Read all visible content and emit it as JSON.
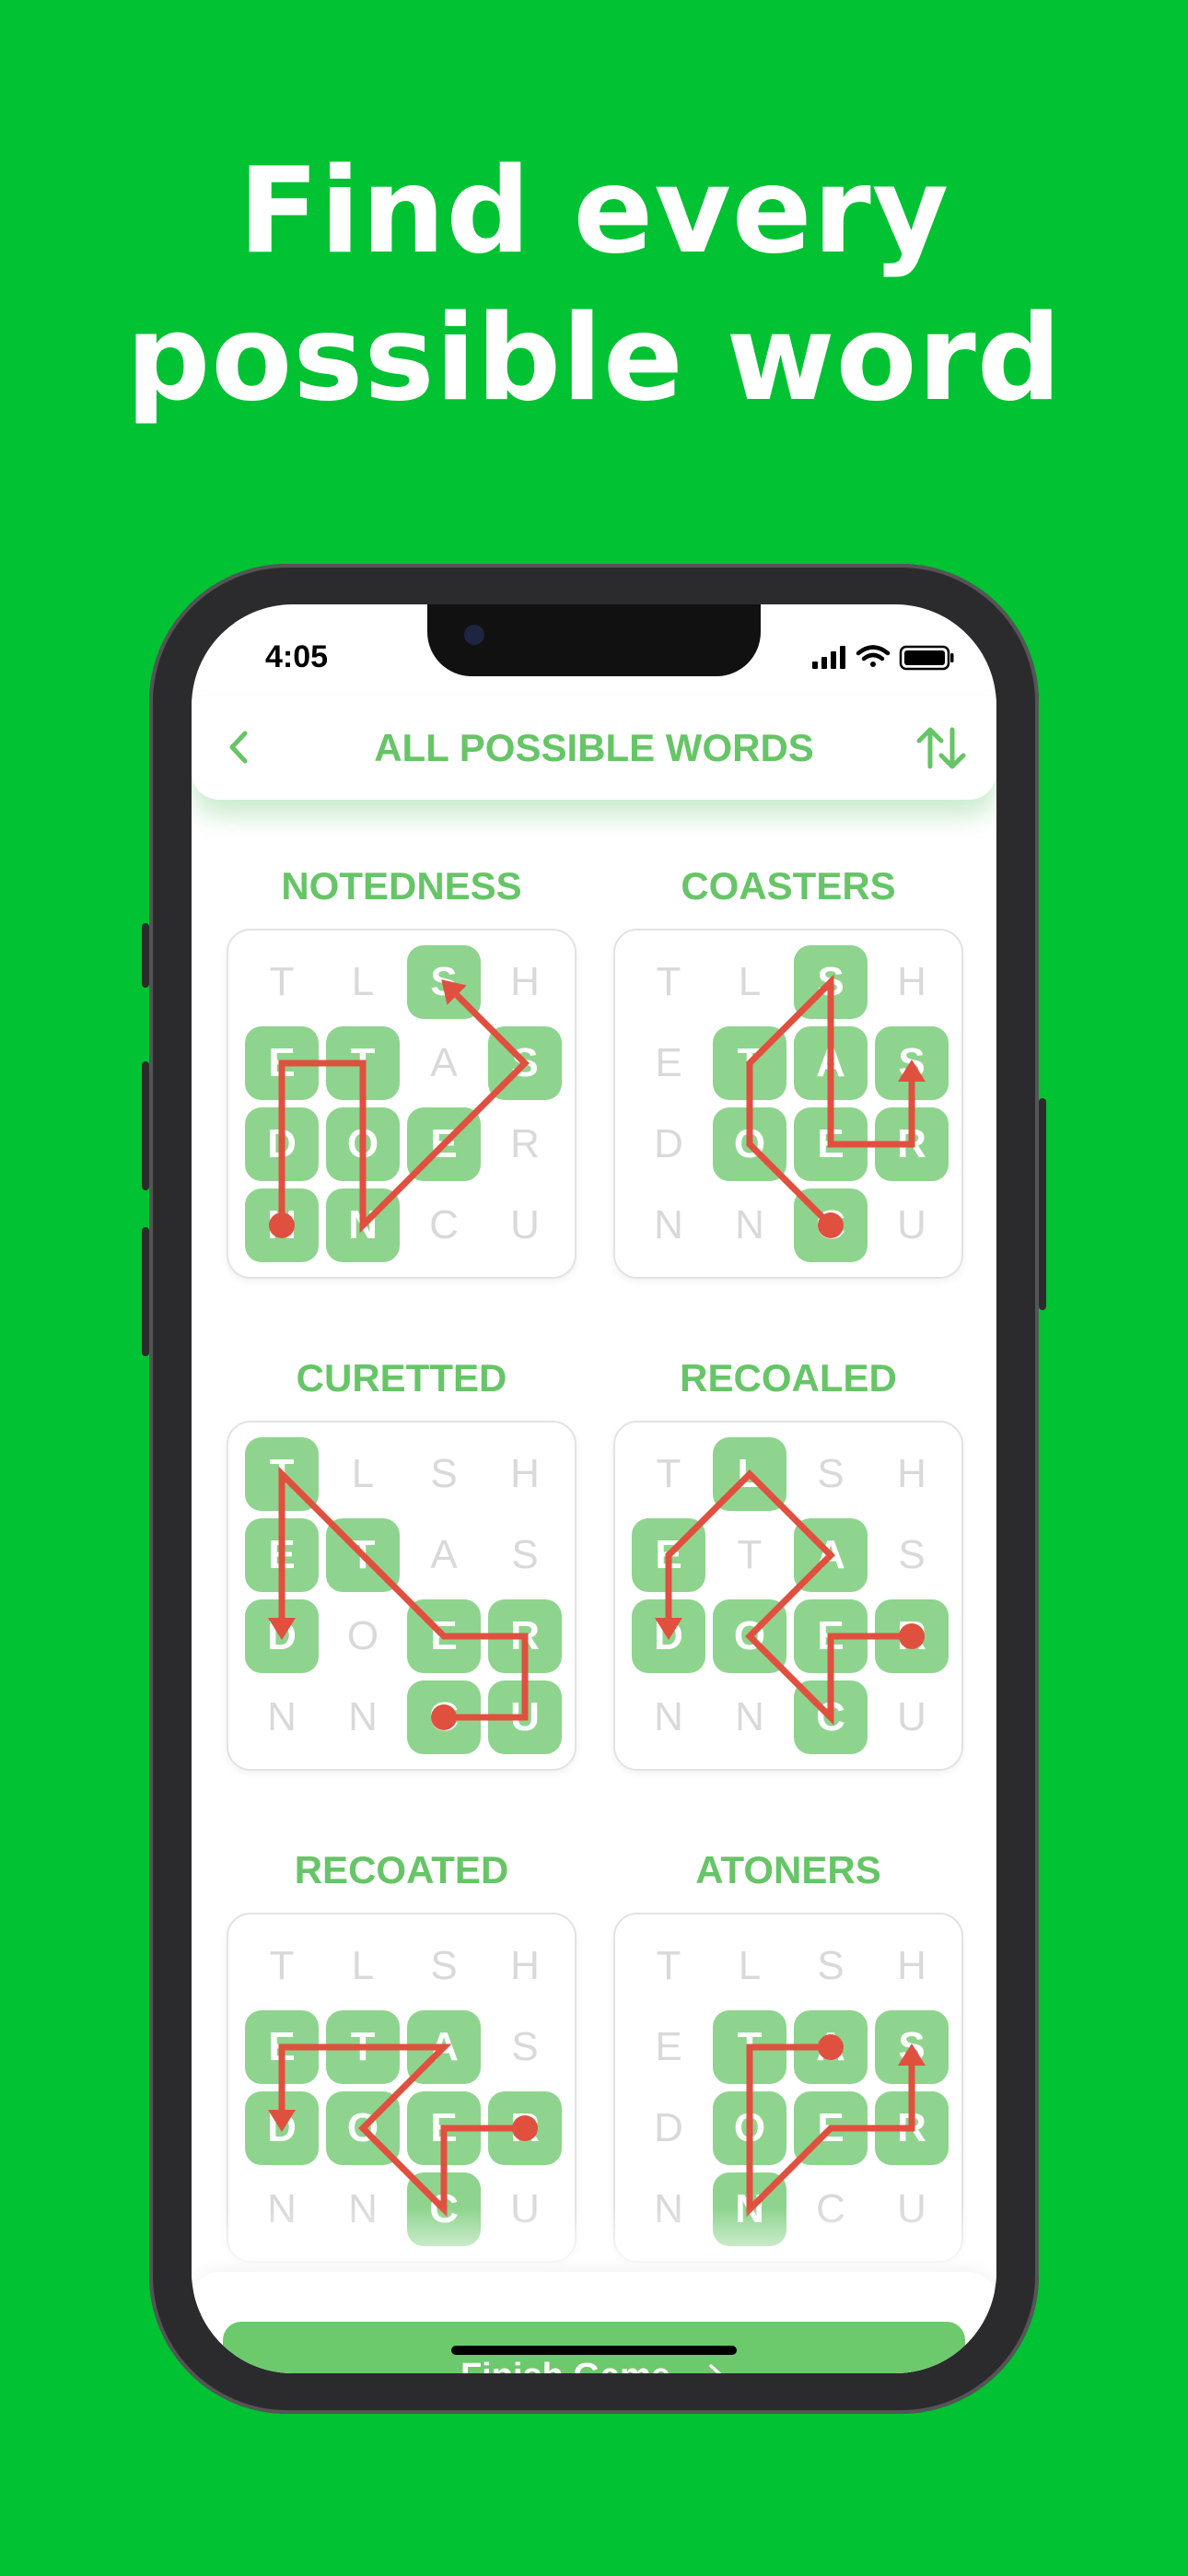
{
  "headline": [
    "Find every",
    "possible word"
  ],
  "status": {
    "time": "4:05",
    "icons": [
      "signal-icon",
      "wifi-icon",
      "battery-icon"
    ]
  },
  "header": {
    "title": "ALL POSSIBLE WORDS",
    "back_icon": "chevron-left-icon",
    "sort_icon": "sort-arrows-icon"
  },
  "colors": {
    "background": "#00c232",
    "accent": "#66c566",
    "tile": "#8ed48e",
    "path": "#e0503f"
  },
  "board_letters": [
    [
      "T",
      "L",
      "S",
      "H"
    ],
    [
      "E",
      "T",
      "A",
      "S"
    ],
    [
      "D",
      "O",
      "E",
      "R"
    ],
    [
      "N",
      "N",
      "C",
      "U"
    ]
  ],
  "words": [
    {
      "word": "NOTEDNESS",
      "path": [
        [
          3,
          0
        ],
        [
          2,
          0
        ],
        [
          1,
          0
        ],
        [
          1,
          1
        ],
        [
          2,
          1
        ],
        [
          3,
          1
        ],
        [
          2,
          2
        ],
        [
          1,
          3
        ],
        [
          0,
          2
        ]
      ]
    },
    {
      "word": "COASTERS",
      "path": [
        [
          3,
          2
        ],
        [
          2,
          1
        ],
        [
          1,
          1
        ],
        [
          0,
          2
        ],
        [
          1,
          2
        ],
        [
          2,
          2
        ],
        [
          2,
          3
        ],
        [
          1,
          3
        ]
      ]
    },
    {
      "word": "CURETTED",
      "path": [
        [
          3,
          2
        ],
        [
          3,
          3
        ],
        [
          2,
          3
        ],
        [
          2,
          2
        ],
        [
          1,
          1
        ],
        [
          0,
          0
        ],
        [
          1,
          0
        ],
        [
          2,
          0
        ]
      ]
    },
    {
      "word": "RECOALED",
      "path": [
        [
          2,
          3
        ],
        [
          2,
          2
        ],
        [
          3,
          2
        ],
        [
          2,
          1
        ],
        [
          1,
          2
        ],
        [
          0,
          1
        ],
        [
          1,
          0
        ],
        [
          2,
          0
        ]
      ]
    },
    {
      "word": "RECOATED",
      "path": [
        [
          2,
          3
        ],
        [
          2,
          2
        ],
        [
          3,
          2
        ],
        [
          2,
          1
        ],
        [
          1,
          2
        ],
        [
          1,
          1
        ],
        [
          1,
          0
        ],
        [
          2,
          0
        ]
      ]
    },
    {
      "word": "ATONERS",
      "path": [
        [
          1,
          2
        ],
        [
          1,
          1
        ],
        [
          2,
          1
        ],
        [
          3,
          1
        ],
        [
          2,
          2
        ],
        [
          2,
          3
        ],
        [
          1,
          3
        ]
      ]
    }
  ],
  "footer": {
    "button_label": "Finish Game",
    "button_icon": "arrow-right-icon"
  }
}
